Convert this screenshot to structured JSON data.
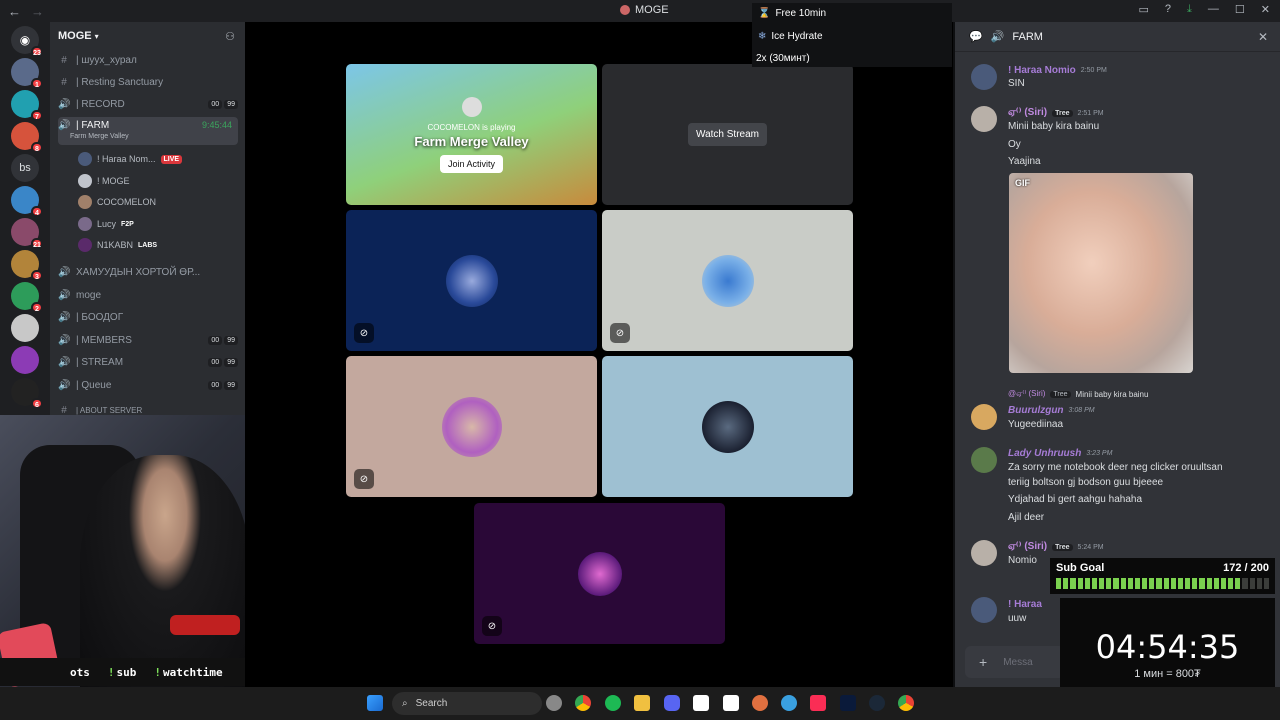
{
  "window": {
    "title": "MOGE"
  },
  "server": {
    "name": "MOGE"
  },
  "rail_badges": [
    "23",
    "1",
    "7",
    "8",
    "4",
    "21",
    "3",
    "2",
    "6"
  ],
  "rail_label": "bs",
  "channels": [
    {
      "icon": "#",
      "label": "| шууx_хурал"
    },
    {
      "icon": "#",
      "label": "| Resting Sanctuary"
    },
    {
      "icon": "🔊",
      "label": "| RECORD",
      "counts": [
        "00",
        "99"
      ]
    },
    {
      "icon": "🔊",
      "label": "| FARM",
      "timer": "9:45:44",
      "status": "Farm Merge Valley"
    },
    {
      "icon": "🔊",
      "label": "ХАМУУДЫН ХОРТОЙ ӨР..."
    },
    {
      "icon": "🔊",
      "label": "moge"
    },
    {
      "icon": "🔊",
      "label": "| БООДОГ"
    },
    {
      "icon": "🔊",
      "label": "| MEMBERS",
      "counts": [
        "00",
        "99"
      ]
    },
    {
      "icon": "🔊",
      "label": "| STREAM",
      "counts": [
        "00",
        "99"
      ]
    },
    {
      "icon": "🔊",
      "label": "| Queue",
      "counts": [
        "00",
        "99"
      ]
    },
    {
      "icon": "#",
      "label": "| ABOUT SERVER"
    }
  ],
  "voice_users": [
    {
      "name": "! Haraa Nom...",
      "live": "LIVE"
    },
    {
      "name": "! MOGE"
    },
    {
      "name": "COCOMELON"
    },
    {
      "name": "Lucy",
      "tag": "F2P"
    },
    {
      "name": "N1KABN",
      "tag": "LABS"
    }
  ],
  "commands": [
    "ots",
    "sub",
    "watchtime"
  ],
  "timers": {
    "t1": "Free 10min",
    "t2": "Ice Hydrate",
    "t3": "2x (30минт)"
  },
  "activity": {
    "playing": "COCOMELON is playing",
    "game": "Farm Merge Valley",
    "join": "Join Activity"
  },
  "stream": {
    "watch": "Watch Stream"
  },
  "chat": {
    "channel": "FARM",
    "messages": [
      {
        "author": "! Haraa Nomio",
        "time": "2:50 PM",
        "lines": [
          "SIN"
        ]
      },
      {
        "author": "ஏ⁽⁾ (Siri)",
        "tag": "Tree",
        "time": "2:51 PM",
        "lines": [
          "Minii baby kira bainu",
          "Oy",
          "Yaajina"
        ]
      },
      {
        "reply": "Minii baby kira bainu",
        "reply_author": "@ஏ⁽⁾ (Siri)",
        "reply_tag": "Tree",
        "author": "Buurulzgun",
        "time": "3:08 PM",
        "lines": [
          "Yugeediinaa"
        ]
      },
      {
        "author": "Lady Unhruush",
        "time": "3:23 PM",
        "lines": [
          "Za sorry me notebook deer neg clicker oruultsan",
          "teriig boltson gj bodson guu bjeeee",
          "Ydjahad bi gert aahgu hahaha",
          "Ajil deer"
        ]
      },
      {
        "author": "ஏ⁽⁾ (Siri)",
        "tag": "Tree",
        "time": "5:24 PM",
        "lines": [
          "Nomio"
        ]
      },
      {
        "author": "! Haraa",
        "lines": [
          "uuw"
        ]
      }
    ],
    "gif_label": "GIF",
    "input_placeholder": "Messa"
  },
  "sub_goal": {
    "label": "Sub Goal",
    "count": "172 / 200",
    "progress": 0.86
  },
  "clock": {
    "time": "04:54:35",
    "rate": "1 мин = 800₮"
  },
  "taskbar": {
    "search": "Search"
  }
}
